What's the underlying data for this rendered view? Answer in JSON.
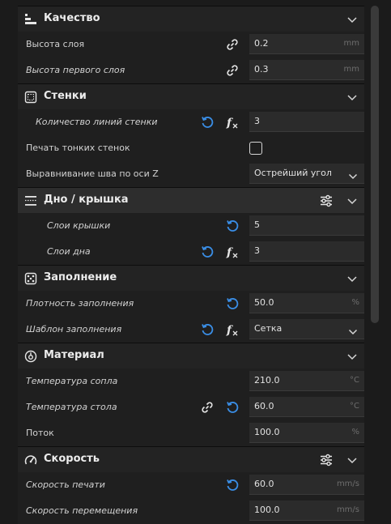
{
  "sections": {
    "quality": {
      "title": "Качество",
      "icon": "layers-icon"
    },
    "walls": {
      "title": "Стенки",
      "icon": "walls-icon"
    },
    "bottom_top": {
      "title": "Дно / крышка",
      "icon": "bottom-top-icon"
    },
    "infill": {
      "title": "Заполнение",
      "icon": "infill-icon"
    },
    "material": {
      "title": "Материал",
      "icon": "material-icon"
    },
    "speed": {
      "title": "Скорость",
      "icon": "speedometer-icon"
    }
  },
  "settings": {
    "layer_height": {
      "label": "Высота слоя",
      "value": "0.2",
      "unit": "mm"
    },
    "first_layer_height": {
      "label": "Высота первого слоя",
      "value": "0.3",
      "unit": "mm"
    },
    "wall_line_count": {
      "label": "Количество линий стенки",
      "value": "3"
    },
    "print_thin_walls": {
      "label": "Печать тонких стенок",
      "checked": false
    },
    "z_seam_alignment": {
      "label": "Выравнивание шва по оси Z",
      "value": "Острейший угол"
    },
    "top_layers": {
      "label": "Слои крышки",
      "value": "5"
    },
    "bottom_layers": {
      "label": "Слои дна",
      "value": "3"
    },
    "infill_density": {
      "label": "Плотность заполнения",
      "value": "50.0",
      "unit": "%"
    },
    "infill_pattern": {
      "label": "Шаблон заполнения",
      "value": "Сетка"
    },
    "nozzle_temp": {
      "label": "Температура сопла",
      "value": "210.0",
      "unit": "°C"
    },
    "bed_temp": {
      "label": "Температура стола",
      "value": "60.0",
      "unit": "°C"
    },
    "flow": {
      "label": "Поток",
      "value": "100.0",
      "unit": "%"
    },
    "print_speed": {
      "label": "Скорость печати",
      "value": "60.0",
      "unit": "mm/s"
    },
    "travel_speed": {
      "label": "Скорость перемещения",
      "value": "100.0",
      "unit": "mm/s"
    }
  },
  "colors": {
    "accent": "#3a8ee6",
    "background": "#1f1f1f",
    "field": "#2b2b2b",
    "text": "#d6d6d6"
  }
}
